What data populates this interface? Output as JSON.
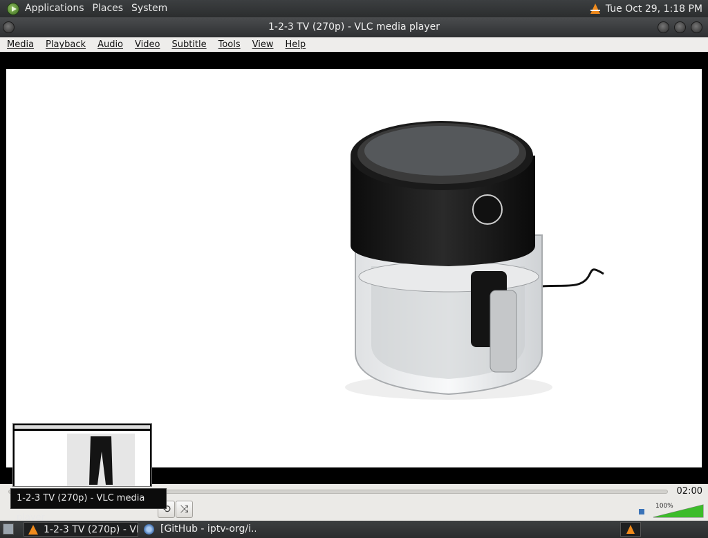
{
  "top_panel": {
    "menus": [
      "Applications",
      "Places",
      "System"
    ],
    "clock": "Tue Oct 29,  1:18 PM"
  },
  "window": {
    "title": "1-2-3 TV (270p) - VLC media player"
  },
  "menubar": [
    "Media",
    "Playback",
    "Audio",
    "Video",
    "Subtitle",
    "Tools",
    "View",
    "Help"
  ],
  "player": {
    "elapsed_fraction": 0.0,
    "time": "02:00",
    "volume_label": "100%",
    "volume_fraction": 1.0
  },
  "tooltip": {
    "text": "1-2-3 TV (270p) - VLC media player"
  },
  "taskbar": {
    "tasks": [
      "1-2-3 TV (270p) - VL...",
      "[GitHub - iptv-org/i..."
    ]
  },
  "colors": {
    "vlc_orange": "#f08a1c",
    "volume_green": "#3cbc2a"
  }
}
